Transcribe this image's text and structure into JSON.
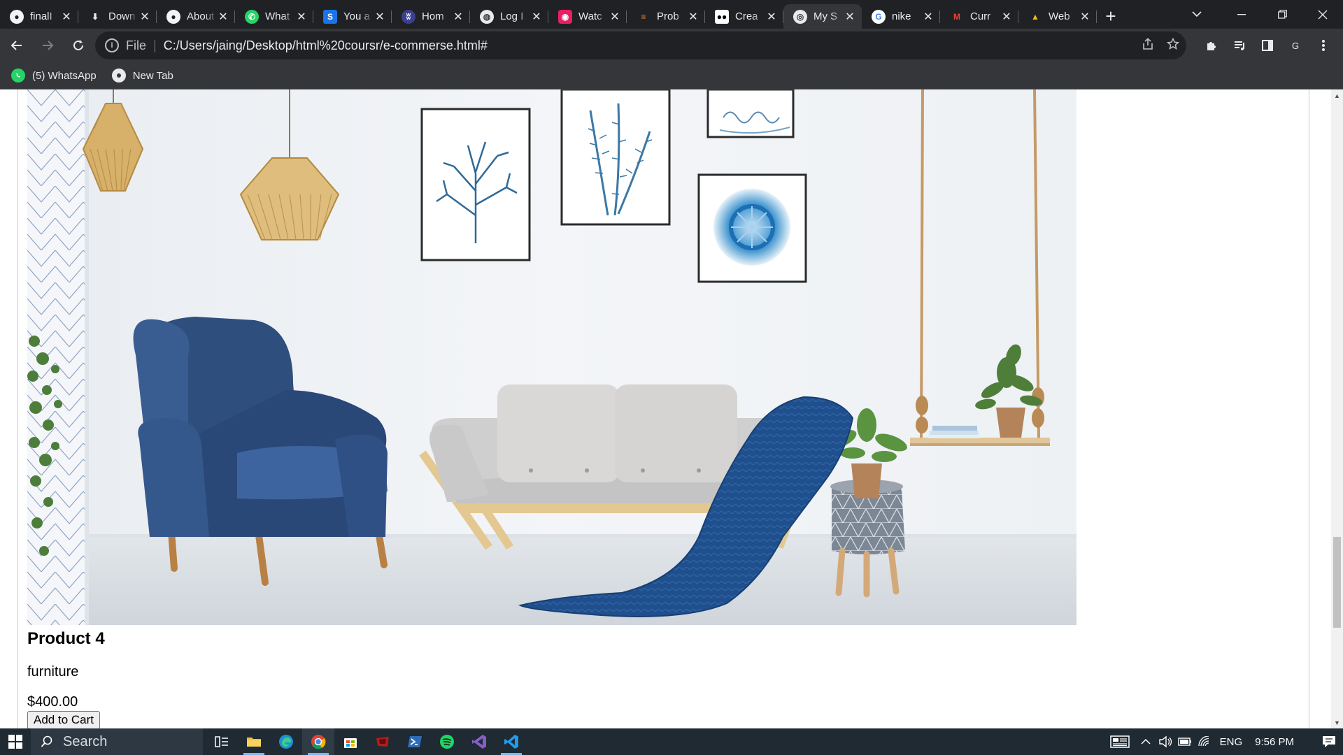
{
  "browser": {
    "tabs": [
      {
        "title": "finalI",
        "icon": "github-icon",
        "active": false
      },
      {
        "title": "Down",
        "icon": "download-icon",
        "active": false
      },
      {
        "title": "About",
        "icon": "github-icon",
        "active": false
      },
      {
        "title": "What",
        "icon": "whatsapp-icon",
        "active": false
      },
      {
        "title": "You a",
        "icon": "s-logo-icon",
        "active": false
      },
      {
        "title": "Hom",
        "icon": "hex-logo-icon",
        "active": false
      },
      {
        "title": "Log I",
        "icon": "globe-logo-icon",
        "active": false
      },
      {
        "title": "Watc",
        "icon": "camera-logo-icon",
        "active": false
      },
      {
        "title": "Prob",
        "icon": "stack-logo-icon",
        "active": false
      },
      {
        "title": "Crea",
        "icon": "medium-logo-icon",
        "active": false
      },
      {
        "title": "My S",
        "icon": "globe-icon",
        "active": true
      },
      {
        "title": "nike",
        "icon": "google-icon",
        "active": false
      },
      {
        "title": "Curr",
        "icon": "gmail-icon",
        "active": false
      },
      {
        "title": "Web",
        "icon": "drive-icon",
        "active": false
      }
    ],
    "address": {
      "scheme_label": "File",
      "url": "C:/Users/jaing/Desktop/html%20coursr/e-commerse.html#"
    },
    "profile_initial": "G",
    "bookmarks": [
      {
        "label": "(5) WhatsApp",
        "icon": "whatsapp-icon"
      },
      {
        "label": "New Tab",
        "icon": "chrome-icon"
      }
    ]
  },
  "product": {
    "title": "Product 4",
    "category": "furniture",
    "price": "$400.00",
    "button_label": "Add to Cart",
    "image_alt": "Living room with blue armchair, beige sofa and wall art"
  },
  "taskbar": {
    "search_placeholder": "Search",
    "language": "ENG",
    "time": "9:56 PM"
  },
  "colors": {
    "chrome_dark": "#202124",
    "chrome_toolbar": "#35363a",
    "taskbar": "#1f2a33",
    "armchair_blue": "#2e4e7e",
    "throw_blue": "#1f4f8c"
  }
}
